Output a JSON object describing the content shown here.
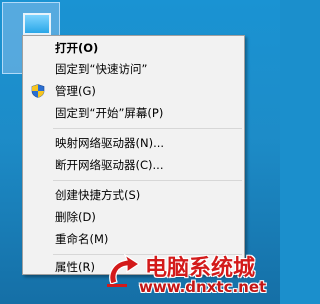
{
  "desktop": {
    "icon_name": "computer-icon"
  },
  "context_menu": {
    "items": [
      {
        "label": "打开(O)",
        "bold": true
      },
      {
        "label": "固定到“快速访问”"
      },
      {
        "label": "管理(G)",
        "icon": "uac-shield-icon"
      },
      {
        "label": "固定到“开始”屏幕(P)"
      },
      {
        "label": "映射网络驱动器(N)..."
      },
      {
        "label": "断开网络驱动器(C)..."
      },
      {
        "label": "创建快捷方式(S)"
      },
      {
        "label": "删除(D)"
      },
      {
        "label": "重命名(M)"
      },
      {
        "label": "属性(R)"
      }
    ]
  },
  "watermark": {
    "title": "电脑系统城",
    "url": "www.dnxtc.net"
  },
  "colors": {
    "menu_bg": "#f2f2f2",
    "desktop_blue": "#1b8fcc",
    "watermark_red": "#d31a1a"
  }
}
